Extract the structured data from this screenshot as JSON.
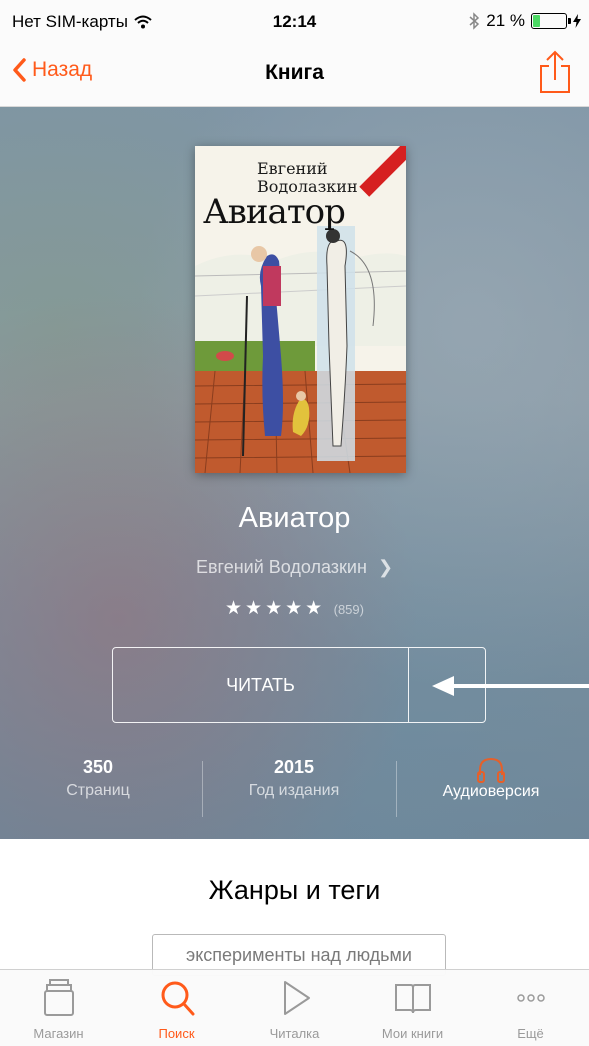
{
  "status_bar": {
    "carrier": "Нет SIM-карты",
    "time": "12:14",
    "battery": "21 %",
    "battery_level": 0.21
  },
  "nav": {
    "back_label": "Назад",
    "title": "Книга"
  },
  "book": {
    "cover_author": "Евгений Водолазкин",
    "cover_title": "Авиатор",
    "title": "Авиатор",
    "author": "Евгений Водолазкин",
    "rating_stars": "★★★★★",
    "rating_count": "(859)",
    "read_label": "ЧИТАТЬ"
  },
  "stats": [
    {
      "value": "350",
      "label": "Страниц"
    },
    {
      "value": "2015",
      "label": "Год издания"
    },
    {
      "label": "Аудиоверсия"
    }
  ],
  "genres": {
    "title": "Жанры и теги",
    "tags": [
      "эксперименты над людьми"
    ]
  },
  "tab_bar": {
    "items": [
      {
        "label": "Магазин",
        "icon": "store-icon"
      },
      {
        "label": "Поиск",
        "icon": "search-icon",
        "active": true
      },
      {
        "label": "Читалка",
        "icon": "play-icon"
      },
      {
        "label": "Мои книги",
        "icon": "book-icon"
      },
      {
        "label": "Ещё",
        "icon": "more-icon"
      }
    ]
  },
  "colors": {
    "accent": "#ff5a1a"
  }
}
